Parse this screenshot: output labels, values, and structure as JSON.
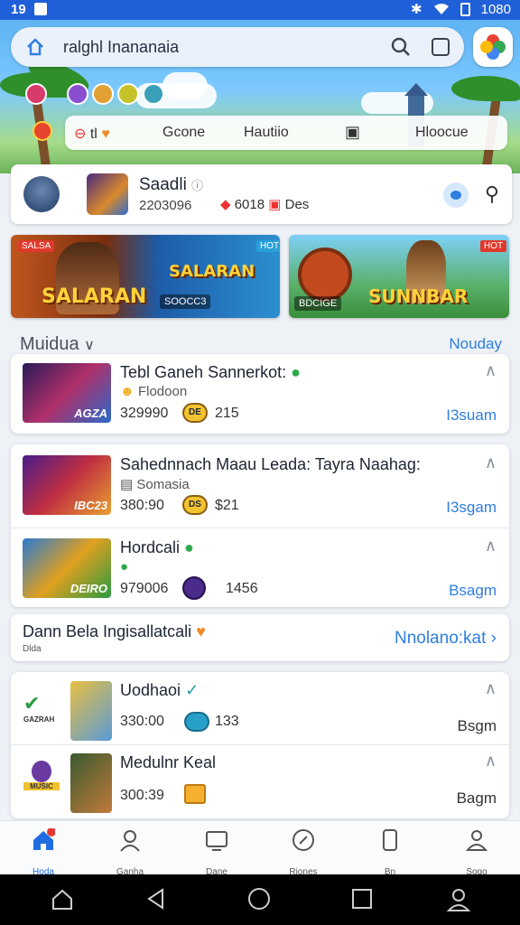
{
  "status_bar": {
    "time": "19",
    "right_text": "1080"
  },
  "search": {
    "text": "ralghl Inananaia"
  },
  "chips": {
    "first": "tl",
    "second": "Gcone",
    "third": "Hautiio",
    "fourth": "Hloocue"
  },
  "profile": {
    "name": "Saadli",
    "id": "2203096",
    "stat_a": "6018",
    "stat_b": "Des"
  },
  "banners": [
    {
      "title": "SALARAN",
      "tag": "SALSA",
      "sub": "SOOCC3",
      "badge": "HOT"
    },
    {
      "title": "SUNNBAR",
      "tag": "HOT",
      "sub": "BDCIGE"
    }
  ],
  "section": {
    "title": "Muidua",
    "link": "Nouday"
  },
  "card1": [
    {
      "title": "Tebl Ganeh Sannerkot:",
      "sub": "Flodoon",
      "num": "329990",
      "coin": "DE",
      "num2": "215",
      "action": "I3suam",
      "thumb_label": "AGZA"
    },
    {
      "title": "Sahednnach Maau Leada: Tayra Naahag:",
      "sub": "Somasia",
      "num": "380:90",
      "coin": "DS",
      "num2": "$21",
      "action": "I3sgam",
      "thumb_label": "IBC23"
    },
    {
      "title": "Hordcali",
      "sub": "",
      "num": "979006",
      "coin": "",
      "num2": "1456",
      "action": "Bsagm",
      "thumb_label": "DEIRO"
    }
  ],
  "promo": {
    "title": "Dann Bela Ingisallatcali",
    "sub": "Dlda",
    "link": "Nnolano:kat"
  },
  "card2": [
    {
      "title": "Uodhaoi",
      "num": "330:00",
      "num2": "133",
      "action": "Bsgm",
      "thumb_label": "GAZRAH"
    },
    {
      "title": "Medulnr Keal",
      "num": "300:39",
      "num2": "",
      "action": "Bagm",
      "thumb_label": "MUSIC"
    }
  ],
  "tabs": [
    "Hoda",
    "Ganha",
    "Dane",
    "Riones",
    "Bn",
    "Sogo"
  ],
  "colors": {
    "accent": "#2f7ee0",
    "header": "#1f5fd8",
    "active_tab": "#1f6de0"
  }
}
